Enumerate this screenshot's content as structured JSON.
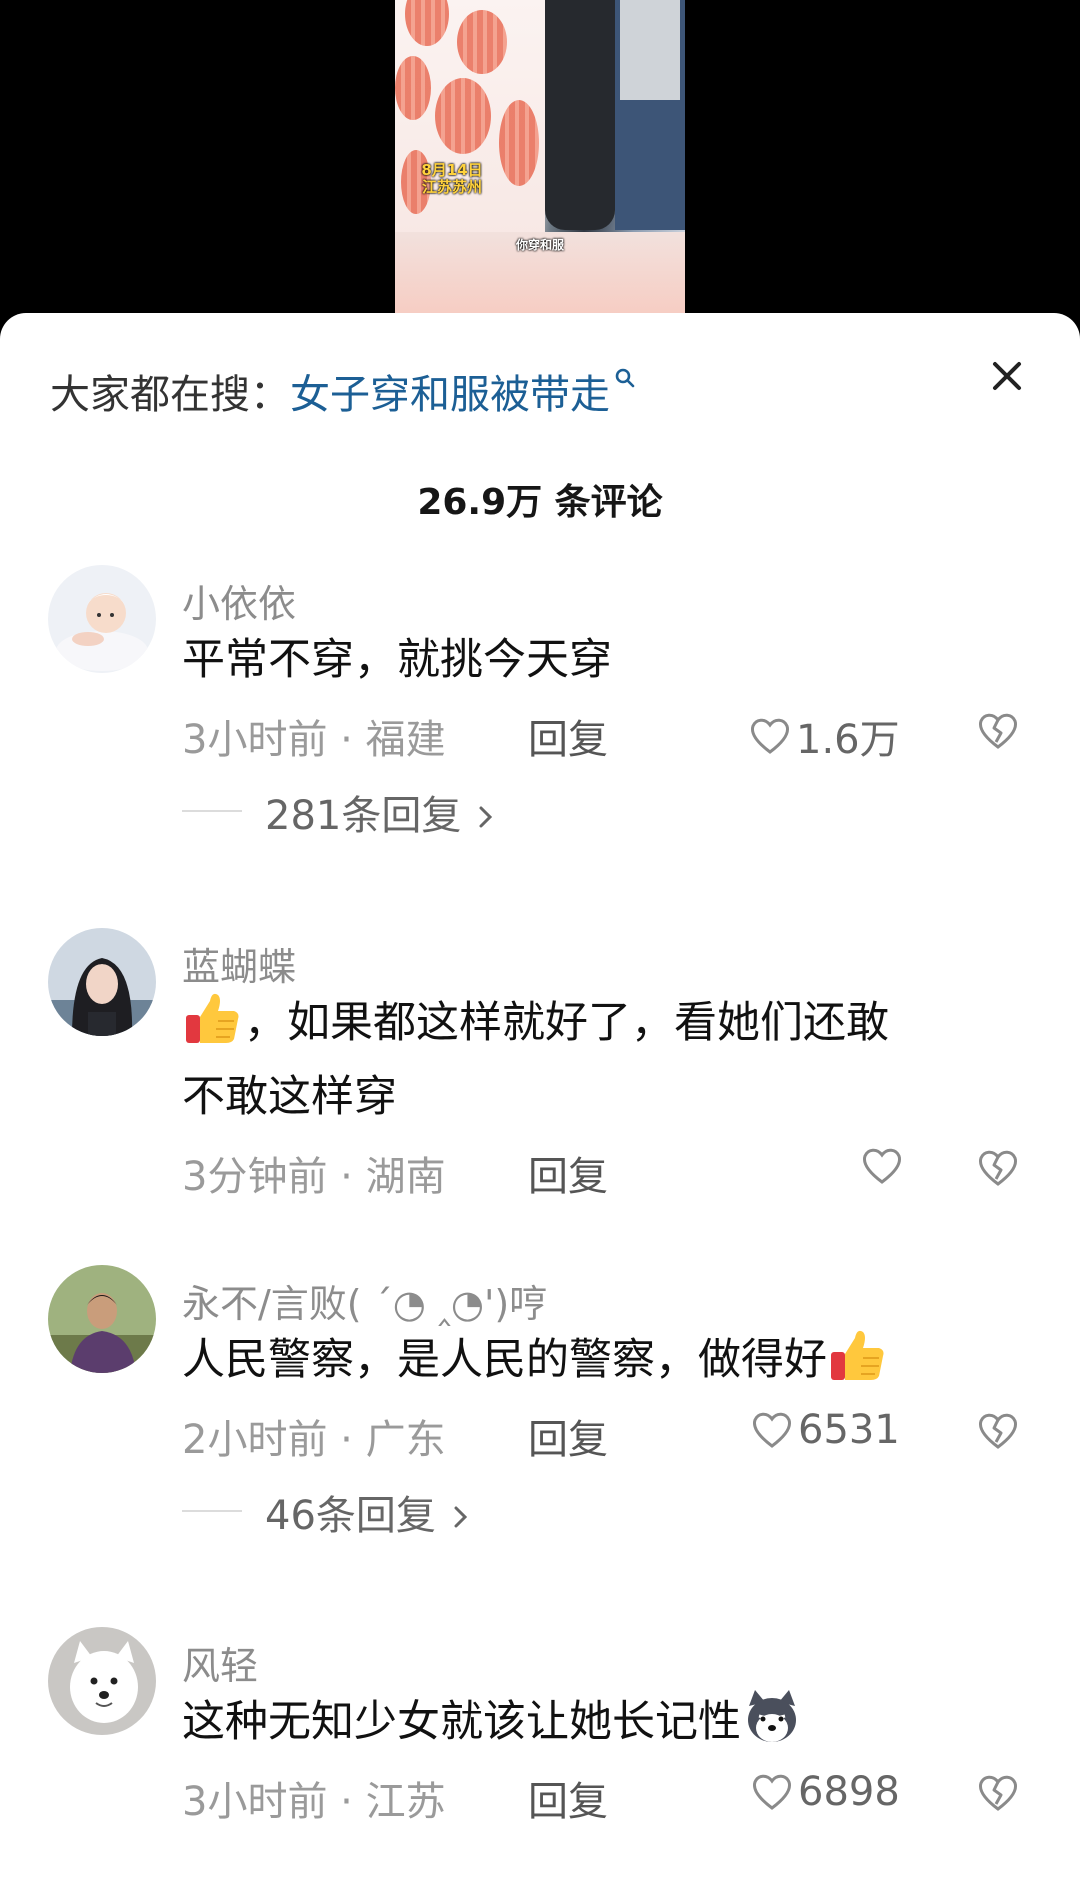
{
  "video": {
    "caption_date": "8月14日 江苏苏州",
    "caption_bottom": "你穿和服"
  },
  "search_suggestion": {
    "label": "大家都在搜：",
    "term": "女子穿和服被带走",
    "icon": "search-icon"
  },
  "comments_header": {
    "count_label": "26.9万 条评论"
  },
  "comments": [
    {
      "username": "小依依",
      "text": "平常不穿，就挑今天穿",
      "time": "3小时前",
      "location": "福建",
      "reply_label": "回复",
      "likes": "1.6万",
      "replies_label": "281条回复"
    },
    {
      "username": "蓝蝴蝶",
      "text_line1": "，如果都这样就好了，看她们还敢",
      "text_line2": "不敢这样穿",
      "emoji_prefix": "thumbs-up-emoji",
      "time": "3分钟前",
      "location": "湖南",
      "reply_label": "回复",
      "likes": ""
    },
    {
      "username": "永不/言败( ´◔ ‸◔')哼",
      "text": "人民警察，是人民的警察，做得好",
      "emoji_suffix": "thumbs-up-emoji",
      "time": "2小时前",
      "location": "广东",
      "reply_label": "回复",
      "likes": "6531",
      "replies_label": "46条回复"
    },
    {
      "username": "风轻",
      "text": "这种无知少女就该让她长记性",
      "emoji_suffix": "dog-emoji",
      "time": "3小时前",
      "location": "江苏",
      "reply_label": "回复",
      "likes": "6898"
    }
  ],
  "meta_separator": " · ",
  "colors": {
    "search_term": "#1c5f95",
    "meta_gray": "#9a9a9a",
    "background_top": "#000000",
    "sheet": "#ffffff"
  }
}
